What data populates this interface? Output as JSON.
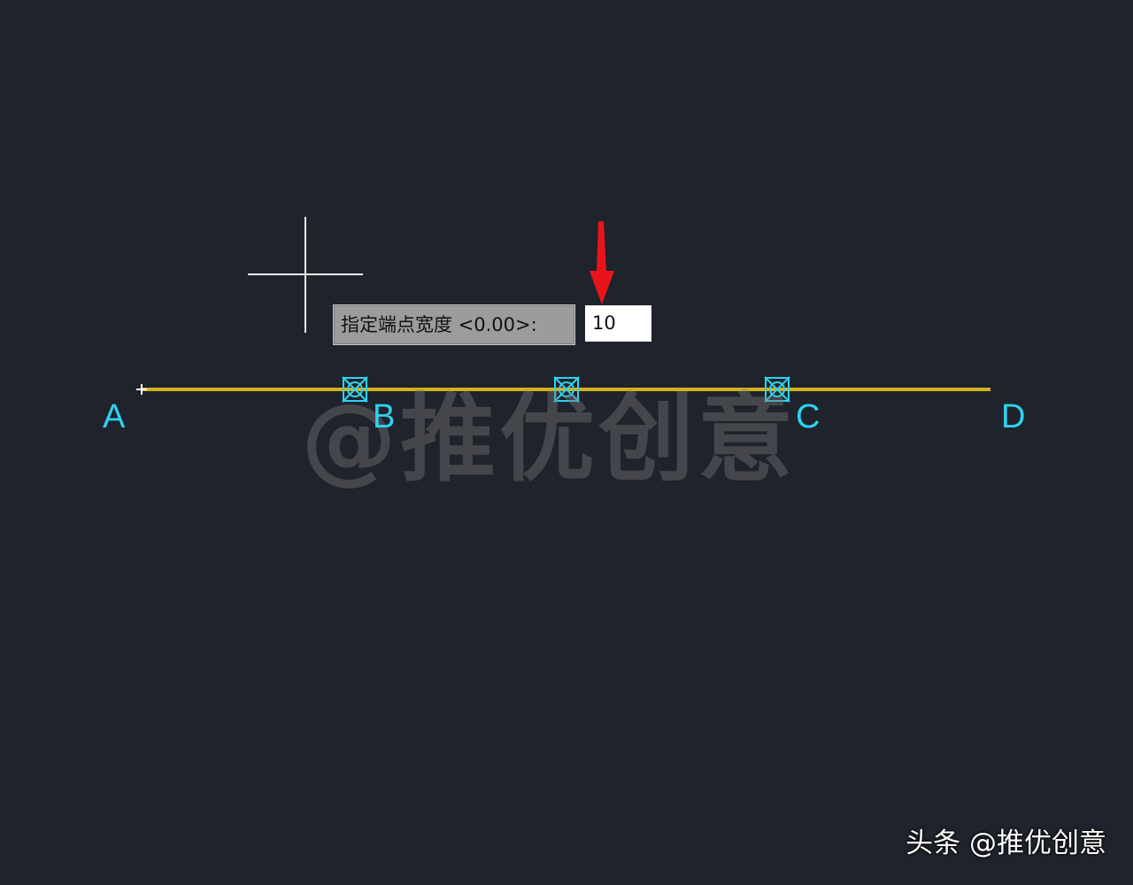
{
  "prompt": {
    "label": "指定端点宽度 <0.00>:",
    "input_value": "10"
  },
  "points": {
    "a": "A",
    "b": "B",
    "c": "C",
    "d": "D"
  },
  "watermark": {
    "center": "@推优创意",
    "corner": "头条 @推优创意"
  },
  "colors": {
    "background": "#1f232c",
    "polyline": "#d4b21b",
    "point_label": "#2ed3f0",
    "grip_marker": "#2ed3f0",
    "crosshair": "#e8e8e8",
    "annotation_arrow": "#e8141c"
  },
  "icons": {
    "cursor": "crosshair-cursor-icon",
    "grip": "node-grip-icon",
    "arrow": "down-arrow-icon"
  }
}
